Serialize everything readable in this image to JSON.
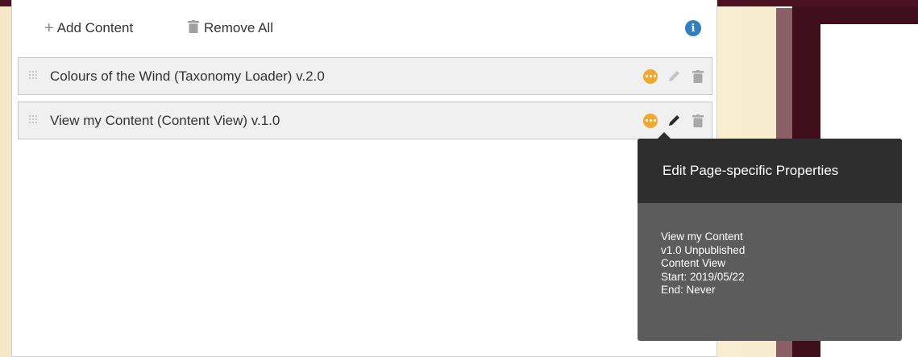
{
  "toolbar": {
    "add_label": "Add Content",
    "add_icon": "plus-icon",
    "remove_label": "Remove All",
    "remove_icon": "trash-icon",
    "info_icon": "info-icon",
    "info_glyph": "i"
  },
  "content_items": [
    {
      "title": "Colours of the Wind (Taxonomy Loader) v.2.0",
      "icons": [
        "drag-handle-icon",
        "more-options-icon",
        "pencil-icon",
        "trash-icon"
      ]
    },
    {
      "title": "View my Content (Content View) v.1.0",
      "icons": [
        "drag-handle-icon",
        "more-options-icon",
        "pencil-icon",
        "trash-icon"
      ]
    }
  ],
  "tooltip": {
    "title": "Edit Page-specific Properties",
    "lines": [
      "View my Content",
      "v1.0 Unpublished",
      "Content View",
      "Start: 2019/05/22",
      "End: Never"
    ]
  },
  "colors": {
    "info_blue": "#2f7fc1",
    "more_orange": "#f0a830",
    "tooltip_header": "#2e2e2e",
    "tooltip_body": "#5c5c5c",
    "background_maroon": "#3e0e1a",
    "background_cream": "#f7ecce"
  }
}
